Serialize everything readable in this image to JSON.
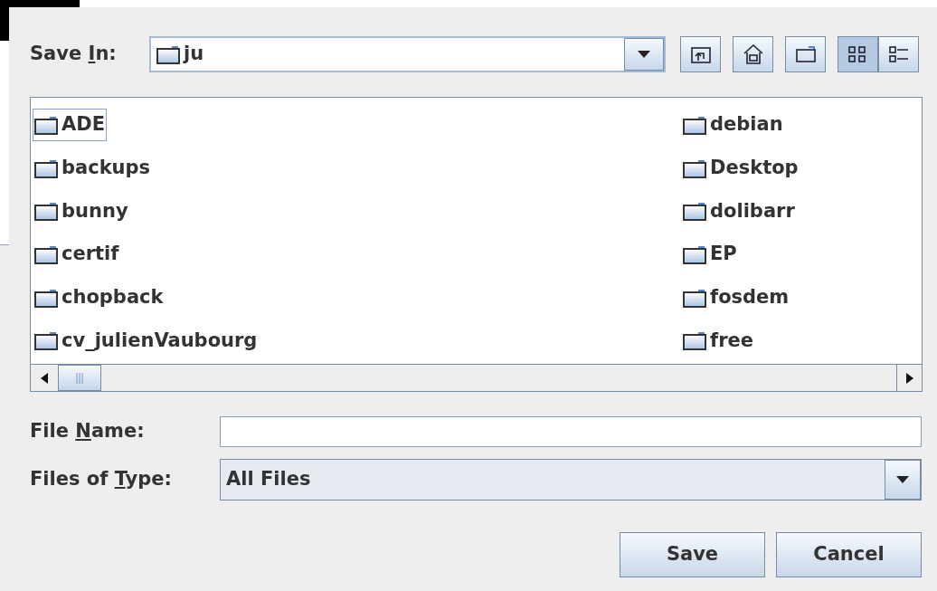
{
  "dialog": {
    "save_in": {
      "label": {
        "before": "Save ",
        "mnemonic": "I",
        "after": "n:"
      },
      "value": "ju"
    },
    "toolbar": [
      {
        "kind": "up"
      },
      {
        "kind": "home"
      },
      {
        "kind": "new_folder"
      }
    ],
    "view_buttons": [
      {
        "kind": "list",
        "selected": true
      },
      {
        "kind": "details",
        "selected": false
      }
    ],
    "files": [
      {
        "name": "ADE",
        "focused": true
      },
      {
        "name": "backups",
        "focused": false
      },
      {
        "name": "bunny",
        "focused": false
      },
      {
        "name": "certif",
        "focused": false
      },
      {
        "name": "chopback",
        "focused": false
      },
      {
        "name": "cv_julienVaubourg",
        "focused": false
      },
      {
        "name": "debian",
        "focused": false
      },
      {
        "name": "Desktop",
        "focused": false
      },
      {
        "name": "dolibarr",
        "focused": false
      },
      {
        "name": "EP",
        "focused": false
      },
      {
        "name": "fosdem",
        "focused": false
      },
      {
        "name": "free",
        "focused": false
      }
    ],
    "file_name": {
      "label": {
        "before": "File ",
        "mnemonic": "N",
        "after": "ame:"
      }
    },
    "file_type": {
      "label": {
        "before": "Files of ",
        "mnemonic": "T",
        "after": "ype:"
      },
      "value": "All Files"
    },
    "buttons": [
      "Save",
      "Cancel"
    ]
  }
}
